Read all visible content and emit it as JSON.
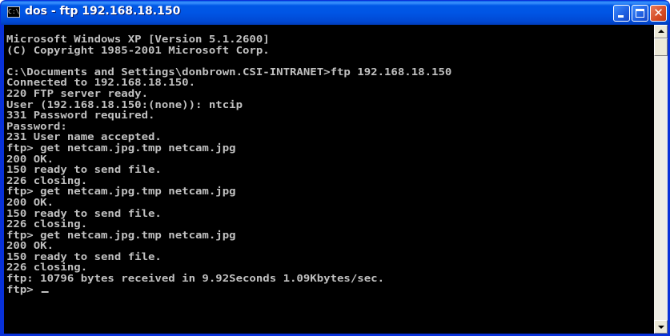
{
  "window": {
    "title": "dos - ftp 192.168.18.150",
    "icon": "console-icon",
    "icon_glyph": "C:\\"
  },
  "titlebar_buttons": {
    "minimize": "minimize-icon",
    "maximize": "maximize-icon",
    "close": "close-icon",
    "close_glyph": "✕"
  },
  "console": {
    "background": "#000000",
    "foreground": "#c0c0c0",
    "lines": [
      "Microsoft Windows XP [Version 5.1.2600]",
      "(C) Copyright 1985-2001 Microsoft Corp.",
      "",
      "C:\\Documents and Settings\\donbrown.CSI-INTRANET>ftp 192.168.18.150",
      "Connected to 192.168.18.150.",
      "220 FTP server ready.",
      "User (192.168.18.150:(none)): ntcip",
      "331 Password required.",
      "Password:",
      "231 User name accepted.",
      "ftp> get netcam.jpg.tmp netcam.jpg",
      "200 OK.",
      "150 ready to send file.",
      "226 closing.",
      "ftp> get netcam.jpg.tmp netcam.jpg",
      "200 OK.",
      "150 ready to send file.",
      "226 closing.",
      "ftp> get netcam.jpg.tmp netcam.jpg",
      "200 OK.",
      "150 ready to send file.",
      "226 closing.",
      "ftp: 10796 bytes received in 9.92Seconds 1.09Kbytes/sec.",
      "ftp> "
    ]
  },
  "scrollbar": {
    "up_arrow": "scroll-up-icon",
    "down_arrow": "scroll-down-icon"
  }
}
